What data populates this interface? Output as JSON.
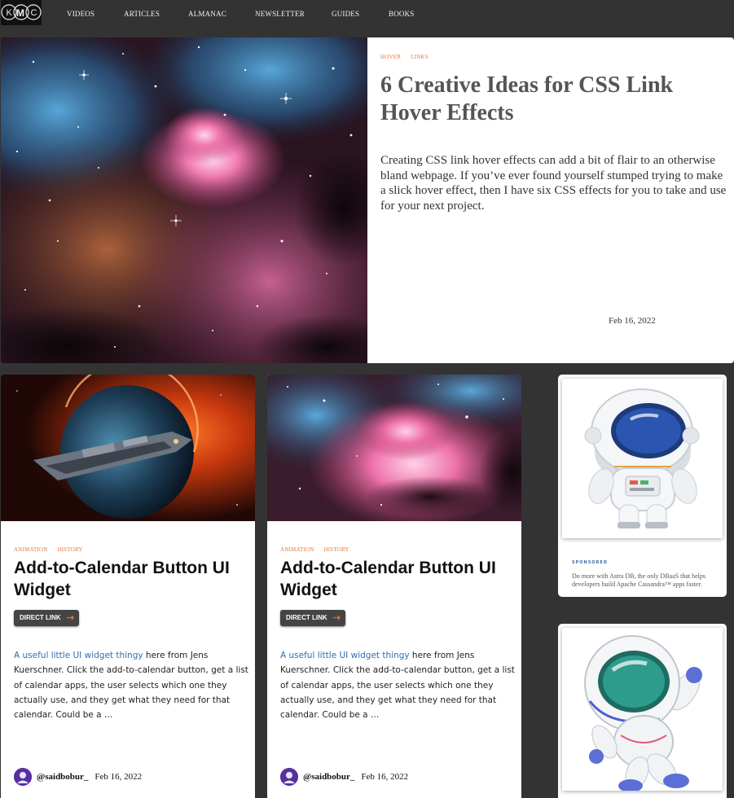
{
  "nav": {
    "logo_text": "CMC",
    "items": [
      "VIDEOS",
      "ARTICLES",
      "ALMANAC",
      "NEWSLETTER",
      "GUIDES",
      "BOOKS"
    ]
  },
  "hero": {
    "tags": [
      "HOVER",
      "LINKS"
    ],
    "title": "6 Creative Ideas for CSS Link Hover Effects",
    "description": "Creating CSS link hover effects can add a bit of flair to an otherwise bland webpage. If you’ve ever found yourself stumped trying to make a slick hover effect, then I have six CSS effects for you to take and use for your next project.",
    "date": "Feb 16, 2022"
  },
  "cards": [
    {
      "tags": [
        "ANIMATION",
        "HISTORY"
      ],
      "title": "Add-to-Calendar Button UI Widget",
      "button_label": "DIRECT LINK",
      "link_text": "A useful little UI widget thingy",
      "body": " here from Jens Kuerschner. Click the add-to-calendar button, get a list of calendar apps, the user selects which one they actually use, and they get what they need for that calendar. Could be a …",
      "author": "@saidbobur_",
      "date": "Feb 16, 2022"
    },
    {
      "tags": [
        "ANIMATION",
        "HISTORY"
      ],
      "title": "Add-to-Calendar Button UI Widget",
      "button_label": "DIRECT LINK",
      "link_text": "A useful little UI widget thingy",
      "body": " here from Jens Kuerschner. Click the add-to-calendar button, get a list of calendar apps, the user selects which one they actually use, and they get what they need for that calendar. Could be a …",
      "author": "@saidbobur_",
      "date": "Feb 16, 2022"
    }
  ],
  "ads": [
    {
      "sponsor_label": "SPONSORED",
      "text": "Do more with Astra DB, the only DBaaS that helps developers build Apache Cassandra™ apps faster."
    }
  ],
  "colors": {
    "background": "#333333",
    "accent_tag": "#e6773a",
    "link": "#2f6fb0",
    "hero_title": "#555555"
  }
}
